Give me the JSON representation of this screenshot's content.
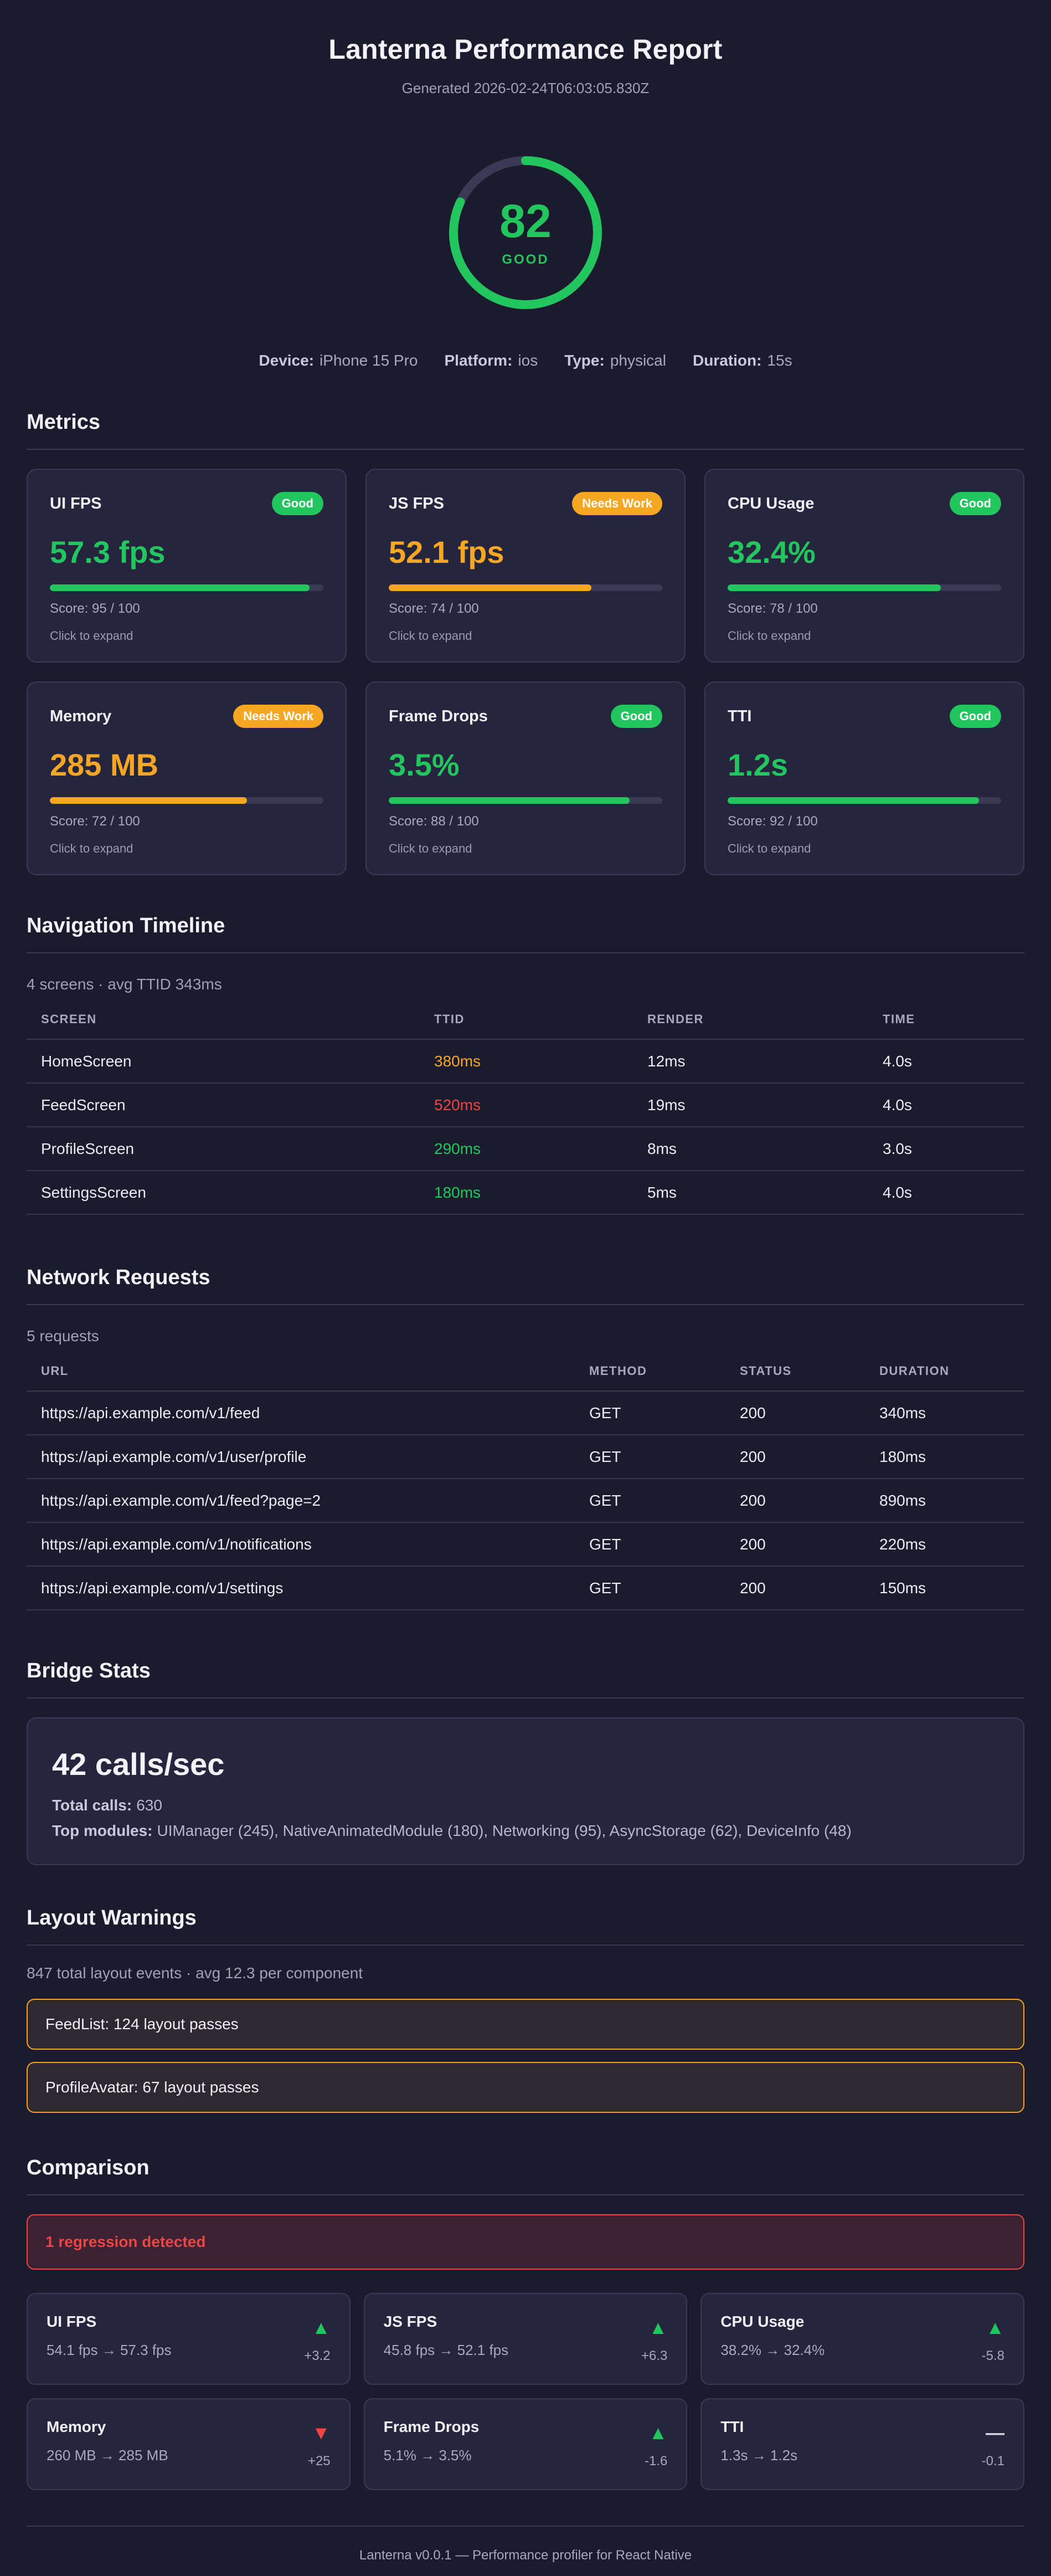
{
  "header": {
    "title": "Lanterna Performance Report",
    "generated": "Generated 2026-02-24T06:03:05.830Z"
  },
  "overall": {
    "score": "82",
    "score_fraction": 0.82,
    "label": "GOOD",
    "accent": "#22c55e"
  },
  "device": {
    "device_label": "Device:",
    "device": "iPhone 15 Pro",
    "platform_label": "Platform:",
    "platform": "ios",
    "type_label": "Type:",
    "type": "physical",
    "duration_label": "Duration:",
    "duration": "15s"
  },
  "metrics": {
    "title": "Metrics",
    "items": [
      {
        "name": "UI FPS",
        "badge": "Good",
        "status": "good",
        "value": "57.3 fps",
        "score_text": "Score: 95 / 100",
        "score": 95,
        "expand": "Click to expand"
      },
      {
        "name": "JS FPS",
        "badge": "Needs Work",
        "status": "warn",
        "value": "52.1 fps",
        "score_text": "Score: 74 / 100",
        "score": 74,
        "expand": "Click to expand"
      },
      {
        "name": "CPU Usage",
        "badge": "Good",
        "status": "good",
        "value": "32.4%",
        "score_text": "Score: 78 / 100",
        "score": 78,
        "expand": "Click to expand"
      },
      {
        "name": "Memory",
        "badge": "Needs Work",
        "status": "warn",
        "value": "285 MB",
        "score_text": "Score: 72 / 100",
        "score": 72,
        "expand": "Click to expand"
      },
      {
        "name": "Frame Drops",
        "badge": "Good",
        "status": "good",
        "value": "3.5%",
        "score_text": "Score: 88 / 100",
        "score": 88,
        "expand": "Click to expand"
      },
      {
        "name": "TTI",
        "badge": "Good",
        "status": "good",
        "value": "1.2s",
        "score_text": "Score: 92 / 100",
        "score": 92,
        "expand": "Click to expand"
      }
    ]
  },
  "navigation": {
    "title": "Navigation Timeline",
    "summary": "4 screens · avg TTID 343ms",
    "columns": [
      "SCREEN",
      "TTID",
      "RENDER",
      "TIME"
    ],
    "rows": [
      {
        "screen": "HomeScreen",
        "ttid": "380ms",
        "ttid_status": "warn",
        "render": "12ms",
        "time": "4.0s"
      },
      {
        "screen": "FeedScreen",
        "ttid": "520ms",
        "ttid_status": "bad",
        "render": "19ms",
        "time": "4.0s"
      },
      {
        "screen": "ProfileScreen",
        "ttid": "290ms",
        "ttid_status": "good",
        "render": "8ms",
        "time": "3.0s"
      },
      {
        "screen": "SettingsScreen",
        "ttid": "180ms",
        "ttid_status": "good",
        "render": "5ms",
        "time": "4.0s"
      }
    ]
  },
  "network": {
    "title": "Network Requests",
    "summary": "5 requests",
    "columns": [
      "URL",
      "METHOD",
      "STATUS",
      "DURATION"
    ],
    "rows": [
      {
        "url": "https://api.example.com/v1/feed",
        "method": "GET",
        "status": "200",
        "duration": "340ms"
      },
      {
        "url": "https://api.example.com/v1/user/profile",
        "method": "GET",
        "status": "200",
        "duration": "180ms"
      },
      {
        "url": "https://api.example.com/v1/feed?page=2",
        "method": "GET",
        "status": "200",
        "duration": "890ms"
      },
      {
        "url": "https://api.example.com/v1/notifications",
        "method": "GET",
        "status": "200",
        "duration": "220ms"
      },
      {
        "url": "https://api.example.com/v1/settings",
        "method": "GET",
        "status": "200",
        "duration": "150ms"
      }
    ]
  },
  "bridge": {
    "title": "Bridge Stats",
    "rate": "42 calls/sec",
    "total_label": "Total calls:",
    "total": "630",
    "modules_label": "Top modules:",
    "modules": "UIManager (245), NativeAnimatedModule (180), Networking (95), AsyncStorage (62), DeviceInfo (48)"
  },
  "layout": {
    "title": "Layout Warnings",
    "summary": "847 total layout events · avg 12.3 per component",
    "warnings": [
      "FeedList: 124 layout passes",
      "ProfileAvatar: 67 layout passes"
    ]
  },
  "comparison": {
    "title": "Comparison",
    "regression": "1 regression detected",
    "items": [
      {
        "name": "UI FPS",
        "range": "54.1 fps → 57.3 fps",
        "arrow": "▲",
        "dir": "up",
        "delta": "+3.2"
      },
      {
        "name": "JS FPS",
        "range": "45.8 fps → 52.1 fps",
        "arrow": "▲",
        "dir": "up",
        "delta": "+6.3"
      },
      {
        "name": "CPU Usage",
        "range": "38.2% → 32.4%",
        "arrow": "▲",
        "dir": "up",
        "delta": "-5.8"
      },
      {
        "name": "Memory",
        "range": "260 MB → 285 MB",
        "arrow": "▼",
        "dir": "down",
        "delta": "+25"
      },
      {
        "name": "Frame Drops",
        "range": "5.1% → 3.5%",
        "arrow": "▲",
        "dir": "up",
        "delta": "-1.6"
      },
      {
        "name": "TTI",
        "range": "1.3s → 1.2s",
        "arrow": "—",
        "dir": "flat",
        "delta": "-0.1"
      }
    ]
  },
  "footer": {
    "text": "Lanterna v0.0.1 — Performance profiler for React Native"
  }
}
